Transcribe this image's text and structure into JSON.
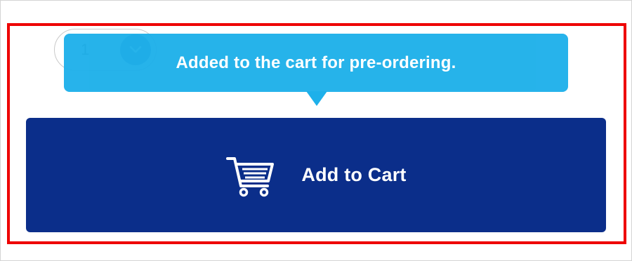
{
  "quantity": {
    "value": "1"
  },
  "tooltip": {
    "message": "Added to the cart for pre-ordering."
  },
  "cart_button": {
    "label": "Add to Cart",
    "icon": "shopping-cart-icon"
  },
  "colors": {
    "button_bg": "#0b2e8a",
    "tooltip_bg": "#1eb0ea",
    "highlight_border": "#ee0000",
    "text_on_dark": "#ffffff"
  }
}
